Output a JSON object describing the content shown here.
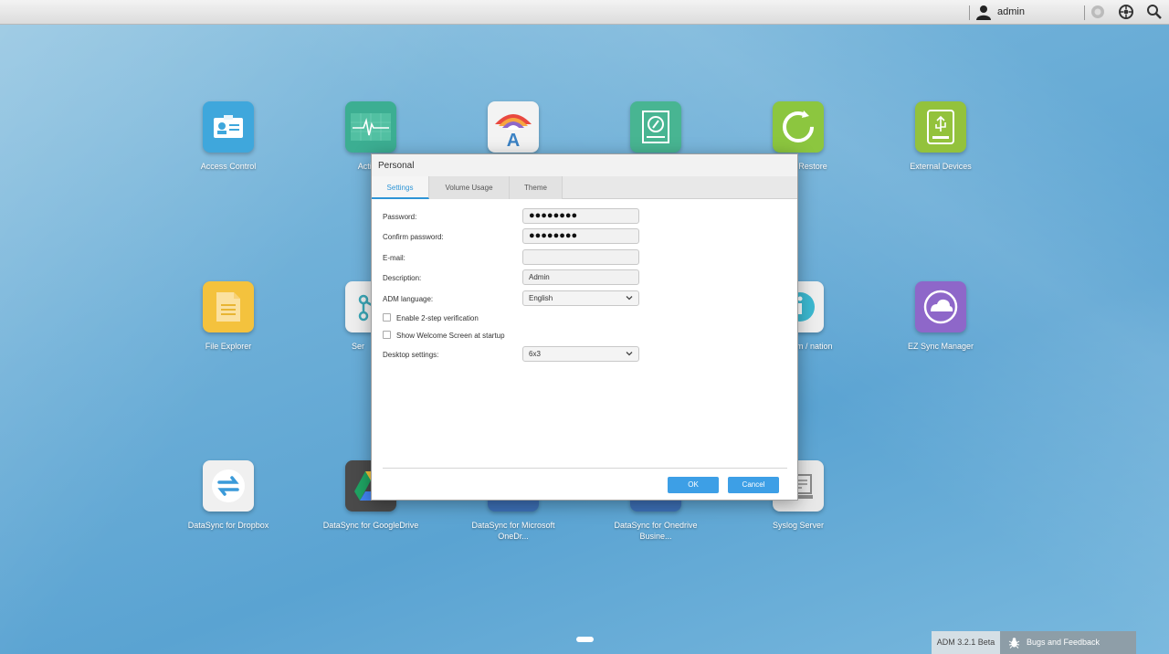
{
  "topbar": {
    "user": "admin",
    "icons": [
      "user-icon",
      "notification-icon",
      "settings-icon",
      "search-icon"
    ]
  },
  "desktop": {
    "apps": [
      {
        "label": "Access Control",
        "icon": "id-card-icon",
        "color": "#3fa7dc"
      },
      {
        "label": "Activity",
        "icon": "activity-monitor-icon",
        "color": "#3cae92"
      },
      {
        "label": "",
        "icon": "app-central-icon",
        "color": "#f3f3f3"
      },
      {
        "label": "",
        "icon": "documentation-icon",
        "color": "#48b592"
      },
      {
        "label": "Restore",
        "icon": "backup-restore-icon",
        "color": "#8cc63f"
      },
      {
        "label": "External Devices",
        "icon": "usb-drive-icon",
        "color": "#93c23c"
      },
      {
        "label": "File Explorer",
        "icon": "folder-icon",
        "color": "#f4c23d"
      },
      {
        "label": "Ser",
        "icon": "services-icon",
        "color": "#eeeeee"
      },
      {
        "label": "tem / nation",
        "icon": "system-information-icon",
        "color": "#eeeeee"
      },
      {
        "label": "EZ Sync Manager",
        "icon": "ez-sync-icon",
        "color": "#8e67c9"
      },
      {
        "label": "DataSync for Dropbox",
        "icon": "datasync-dropbox-icon",
        "color": "#f0f0f0"
      },
      {
        "label": "DataSync for GoogleDrive",
        "icon": "google-drive-icon",
        "color": "#4a4a4a"
      },
      {
        "label": "DataSync for Microsoft OneDr...",
        "icon": "onedrive-icon",
        "color": "#3c6fb5"
      },
      {
        "label": "DataSync for Onedrive Busine...",
        "icon": "onedrive-business-icon",
        "color": "#3c6fb5"
      },
      {
        "label": "Syslog Server",
        "icon": "syslog-icon",
        "color": "#e8e8e8"
      }
    ]
  },
  "dialog": {
    "title": "Personal",
    "tabs": [
      "Settings",
      "Volume Usage",
      "Theme"
    ],
    "active_tab": "Settings",
    "fields": {
      "password_label": "Password:",
      "password_value": "●●●●●●●●",
      "confirm_label": "Confirm password:",
      "confirm_value": "●●●●●●●●",
      "email_label": "E-mail:",
      "email_value": "",
      "description_label": "Description:",
      "description_value": "Admin",
      "language_label": "ADM language:",
      "language_value": "English",
      "two_step_label": "Enable 2-step verification",
      "welcome_label": "Show Welcome Screen at startup",
      "desktop_label": "Desktop settings:",
      "desktop_value": "6x3"
    },
    "ok": "OK",
    "cancel": "Cancel"
  },
  "footer": {
    "version": "ADM 3.2.1 Beta",
    "bugs": "Bugs and Feedback"
  },
  "colors": {
    "accent": "#3d9fe6",
    "tab_active": "#2e95d6"
  }
}
